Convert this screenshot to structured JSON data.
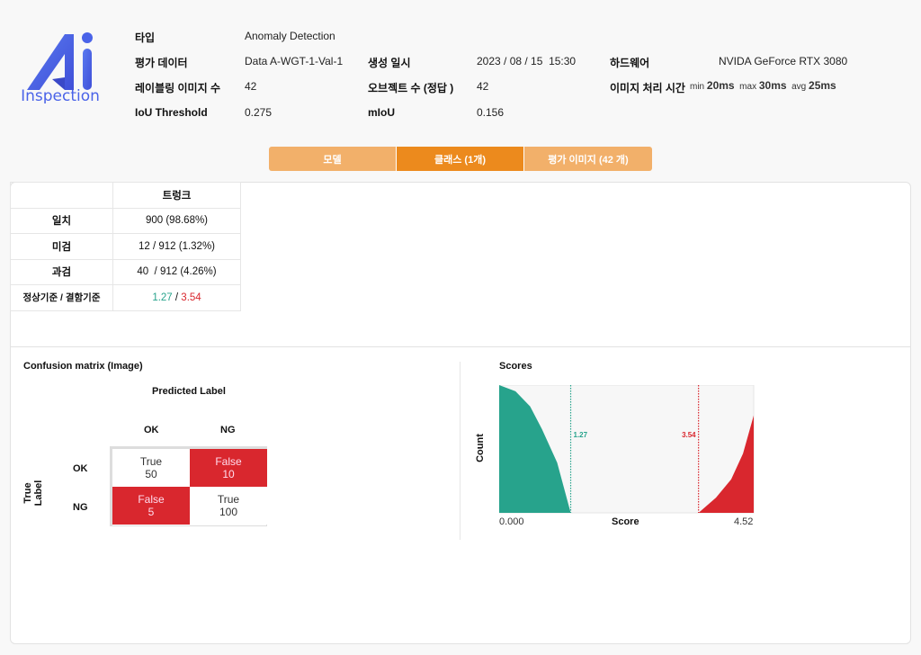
{
  "logo": {
    "text_main": "Ai",
    "text_sub": "Inspection",
    "color": "#4a63e8"
  },
  "info": {
    "type": {
      "label": "타입",
      "value": "Anomaly Detection"
    },
    "eval_data": {
      "label": "평가 데이터",
      "value": "Data A-WGT-1-Val-1"
    },
    "created": {
      "label": "생성 일시",
      "value": "2023 / 08 / 15  15:30"
    },
    "hardware": {
      "label": "하드웨어",
      "value": "NVIDA GeForce RTX 3080"
    },
    "labeled_images": {
      "label": "레이블링 이미지 수",
      "value": "42"
    },
    "objects": {
      "label": "오브젝트 수 (정답 )",
      "value": "42"
    },
    "proc_time": {
      "label": "이미지 처리 시간",
      "min_label": "min",
      "min": "20ms",
      "max_label": "max",
      "max": "30ms",
      "avg_label": "avg",
      "avg": "25ms"
    },
    "iou_threshold": {
      "label": "IoU Threshold",
      "value": "0.275"
    },
    "miou": {
      "label": "mIoU",
      "value": "0.156"
    }
  },
  "tabs": [
    {
      "label": "모델",
      "active": false
    },
    {
      "label": "클래스 (1개)",
      "active": true
    },
    {
      "label": "평가 이미지 (42 개)",
      "active": false
    }
  ],
  "class_table": {
    "header": "트렁크",
    "rows": [
      {
        "label": "일치",
        "value": "900 (98.68%)"
      },
      {
        "label": "미검",
        "value": "12 / 912 (1.32%)"
      },
      {
        "label": "과검",
        "value": "40  / 912 (4.26%)"
      },
      {
        "label": "정상기준 / 결함기준",
        "normal": "1.27",
        "sep": " / ",
        "defect": "3.54"
      }
    ]
  },
  "confusion": {
    "title": "Confusion matrix (Image)",
    "xlabel": "Predicted Label",
    "ylabel": "True Label",
    "cols": [
      "OK",
      "NG"
    ],
    "rows": [
      "OK",
      "NG"
    ],
    "cells": [
      [
        {
          "t": "True",
          "v": "50"
        },
        {
          "t": "False",
          "v": "10"
        }
      ],
      [
        {
          "t": "False",
          "v": "5"
        },
        {
          "t": "True",
          "v": "100"
        }
      ]
    ],
    "colors": {
      "true": "#ffffff",
      "false": "#d9272e"
    }
  },
  "chart_data": {
    "type": "area",
    "title": "Scores",
    "xlabel": "Score",
    "ylabel": "Count",
    "xlim": [
      0,
      4.52
    ],
    "x_tick_labels": [
      "0.000",
      "4.52"
    ],
    "series": [
      {
        "x": [
          0,
          0.29,
          0.55,
          0.76,
          1.03,
          1.27
        ],
        "y": [
          1,
          0.952,
          0.833,
          0.655,
          0.393,
          0
        ],
        "color": "#27a38c"
      },
      {
        "x": [
          3.54,
          3.85,
          4.12,
          4.33,
          4.52
        ],
        "y": [
          0,
          0.119,
          0.262,
          0.464,
          0.762
        ],
        "color": "#d9272e"
      }
    ],
    "thresholds": [
      {
        "value": 1.27,
        "label": "1.27",
        "color": "#27a38c"
      },
      {
        "value": 3.54,
        "label": "3.54",
        "color": "#d9272e"
      }
    ]
  }
}
